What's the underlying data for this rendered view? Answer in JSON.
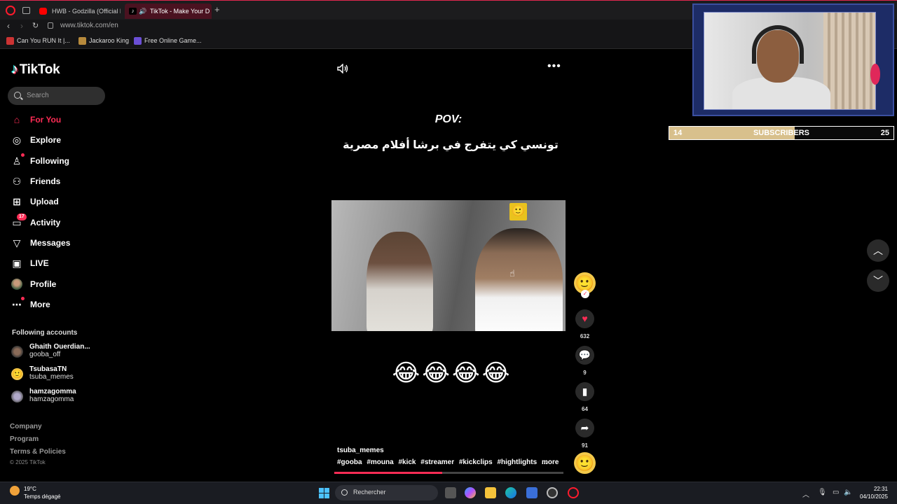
{
  "browser": {
    "tabs": [
      {
        "title": "HWB - Godzilla (Official M"
      },
      {
        "title": "TikTok - Make Your D"
      }
    ],
    "url": "www.tiktok.com/en",
    "bookmarks": [
      {
        "label": "Can You RUN It |..."
      },
      {
        "label": "Jackaroo King"
      },
      {
        "label": "Free Online Game..."
      }
    ]
  },
  "sidebar": {
    "brand": "TikTok",
    "search_placeholder": "Search",
    "nav": [
      {
        "label": "For You",
        "icon": "home-icon"
      },
      {
        "label": "Explore",
        "icon": "compass-icon"
      },
      {
        "label": "Following",
        "icon": "person-icon"
      },
      {
        "label": "Friends",
        "icon": "people-icon"
      },
      {
        "label": "Upload",
        "icon": "plus-square-icon"
      },
      {
        "label": "Activity",
        "icon": "chat-icon",
        "badge": "17"
      },
      {
        "label": "Messages",
        "icon": "send-icon"
      },
      {
        "label": "LIVE",
        "icon": "tv-icon"
      },
      {
        "label": "Profile",
        "icon": "avatar"
      },
      {
        "label": "More",
        "icon": "dots-icon"
      }
    ],
    "following_title": "Following accounts",
    "following": [
      {
        "name": "Ghaith Ouerdian...",
        "handle": "gooba_off"
      },
      {
        "name": "TsubasaTN",
        "handle": "tsuba_memes"
      },
      {
        "name": "hamzagomma",
        "handle": "hamzagomma"
      }
    ],
    "footer": [
      "Company",
      "Program",
      "Terms & Policies"
    ],
    "copyright": "© 2025 TikTok"
  },
  "video": {
    "pov": "POV:",
    "caption_ar": "تونسي كي يتفرج في برشا أفلام مصرية",
    "emojis": "😂😂😂😂",
    "author": "tsuba_memes",
    "hashtags": [
      "#gooba",
      "#mouna",
      "#kick",
      "#streamer",
      "#kickclips",
      "#hightlights",
      "..."
    ],
    "more": "more",
    "progress": 0.47
  },
  "actions": {
    "likes": "632",
    "comments": "9",
    "saves": "64",
    "shares": "91"
  },
  "overlay": {
    "sub_current": "14",
    "sub_label": "SUBSCRIBERS",
    "sub_goal": "25",
    "sub_fraction": 0.56
  },
  "taskbar": {
    "temp": "19°C",
    "weather": "Temps dégagé",
    "search": "Rechercher",
    "time": "22:31",
    "date": "04/10/2025"
  },
  "colors": {
    "accent": "#fe2c55",
    "overlay_fill": "#d8c08c"
  }
}
